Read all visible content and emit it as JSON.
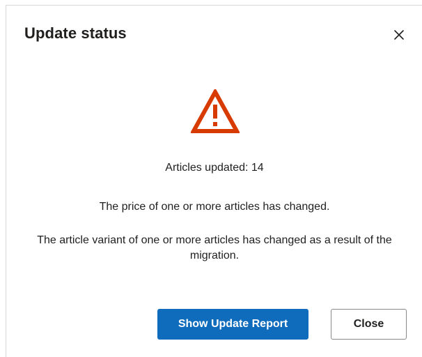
{
  "dialog": {
    "title": "Update status",
    "close_icon": "close-icon",
    "status_icon": "warning-icon",
    "status_icon_color": "#d83b01",
    "messages": {
      "articles_updated": "Articles updated: 14",
      "price_changed": "The price of one or more articles has changed.",
      "variant_changed": "The article variant of one or more articles has changed as a result of the migration."
    },
    "buttons": {
      "primary_label": "Show Update Report",
      "secondary_label": "Close"
    },
    "colors": {
      "primary_button": "#0f6cbd",
      "text": "#201f1e"
    }
  }
}
